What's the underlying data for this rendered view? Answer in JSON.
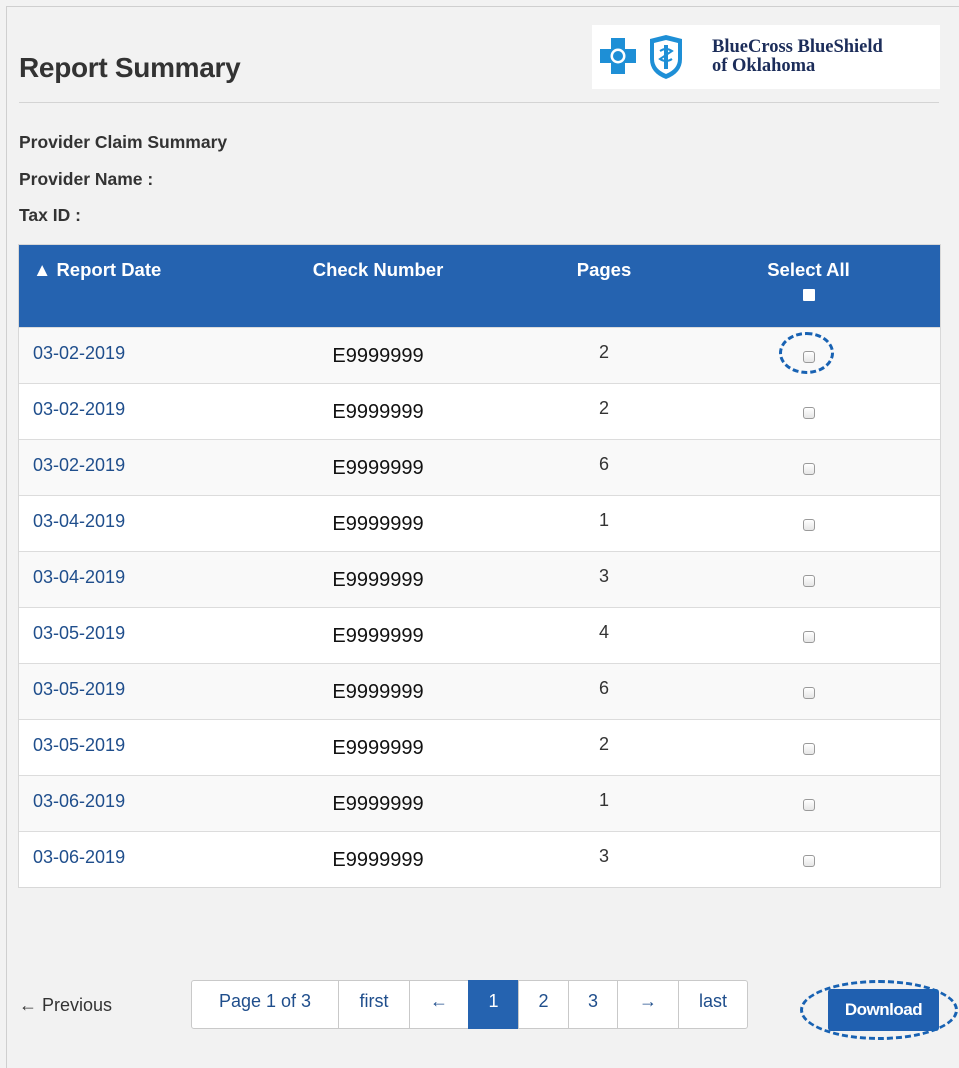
{
  "header": {
    "title": "Report Summary",
    "logo_line1": "BlueCross BlueShield",
    "logo_line2": "of Oklahoma"
  },
  "info": {
    "line1": "Provider Claim Summary",
    "line2": "Provider Name :",
    "line3": "Tax ID :"
  },
  "table": {
    "columns": [
      "▲ Report Date",
      "Check Number",
      "Pages",
      "Select All"
    ],
    "rows": [
      {
        "date": "03-02-2019",
        "check": "E9999999",
        "pages": "2"
      },
      {
        "date": "03-02-2019",
        "check": "E9999999",
        "pages": "2"
      },
      {
        "date": "03-02-2019",
        "check": "E9999999",
        "pages": "6"
      },
      {
        "date": "03-04-2019",
        "check": "E9999999",
        "pages": "1"
      },
      {
        "date": "03-04-2019",
        "check": "E9999999",
        "pages": "3"
      },
      {
        "date": "03-05-2019",
        "check": "E9999999",
        "pages": "4"
      },
      {
        "date": "03-05-2019",
        "check": "E9999999",
        "pages": "6"
      },
      {
        "date": "03-05-2019",
        "check": "E9999999",
        "pages": "2"
      },
      {
        "date": "03-06-2019",
        "check": "E9999999",
        "pages": "1"
      },
      {
        "date": "03-06-2019",
        "check": "E9999999",
        "pages": "3"
      }
    ]
  },
  "pagination": {
    "previous_label": "← Previous",
    "page_info": "Page 1 of 3",
    "first": "first",
    "prev_arrow": "←",
    "pages": [
      "1",
      "2",
      "3"
    ],
    "next_arrow": "→",
    "last": "last"
  },
  "actions": {
    "download_label": "Download"
  },
  "colors": {
    "header_blue": "#2563b0",
    "link_blue": "#1f4e8c",
    "highlight": "#1862b3"
  }
}
